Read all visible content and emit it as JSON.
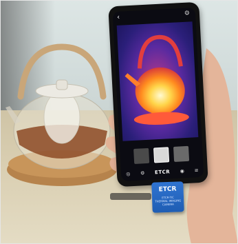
{
  "photo": {
    "phone": {
      "brand_label": "ETCR"
    },
    "camera_module": {
      "logo_text": "ETCR",
      "subtitle_lines": [
        "ETCR-TIC",
        "THERMAL IMAGING",
        "CAMERA"
      ]
    }
  }
}
